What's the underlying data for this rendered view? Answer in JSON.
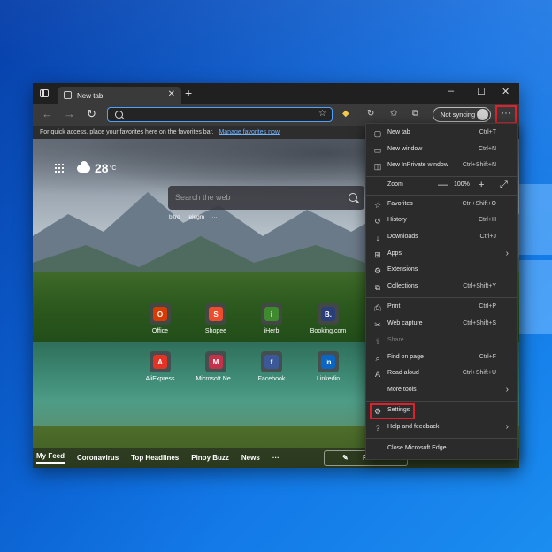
{
  "browser": {
    "tab_title": "New tab",
    "new_tab_symbol": "+",
    "window_controls": [
      "–",
      "☐",
      "✕"
    ],
    "address_placeholder": "",
    "sync_label": "Not syncing",
    "more_symbol": "···",
    "favorites_bar_text": "For quick access, place your favorites here on the favorites bar.",
    "favorites_bar_link": "Manage favorites now"
  },
  "newtab": {
    "temperature": "28",
    "temperature_unit": "°C",
    "search_placeholder": "Search the web",
    "quick_links": [
      "bitro",
      "telegm",
      "···"
    ],
    "tiles": [
      {
        "label": "Office",
        "color": "#d83b01",
        "glyph": "O"
      },
      {
        "label": "Shopee",
        "color": "#ee4d2d",
        "glyph": "S"
      },
      {
        "label": "iHerb",
        "color": "#3f8a2f",
        "glyph": "i"
      },
      {
        "label": "Booking.com",
        "color": "#2a3f7a",
        "glyph": "B."
      },
      {
        "label": "AliExpress",
        "color": "#e43225",
        "glyph": "A"
      },
      {
        "label": "Microsoft Ne...",
        "color": "#c4314b",
        "glyph": "M"
      },
      {
        "label": "Facebook",
        "color": "#3b5998",
        "glyph": "f"
      },
      {
        "label": "Linkedin",
        "color": "#0a66c2",
        "glyph": "in"
      }
    ],
    "feed_tabs": [
      "My Feed",
      "Coronavirus",
      "Top Headlines",
      "Pinoy Buzz",
      "News",
      "···"
    ],
    "personalize_label": "Personalize"
  },
  "menu": {
    "items": [
      {
        "label": "New tab",
        "shortcut": "Ctrl+T",
        "icon": "new-tab-icon",
        "glyph": "▢"
      },
      {
        "label": "New window",
        "shortcut": "Ctrl+N",
        "icon": "window-icon",
        "glyph": "▭"
      },
      {
        "label": "New InPrivate window",
        "shortcut": "Ctrl+Shift+N",
        "icon": "inprivate-icon",
        "glyph": "◫"
      },
      {
        "label": "Zoom",
        "shortcut": "",
        "icon": "",
        "glyph": ""
      },
      {
        "label": "Favorites",
        "shortcut": "Ctrl+Shift+O",
        "icon": "favorites-icon",
        "glyph": "☆"
      },
      {
        "label": "History",
        "shortcut": "Ctrl+H",
        "icon": "history-icon",
        "glyph": "↺"
      },
      {
        "label": "Downloads",
        "shortcut": "Ctrl+J",
        "icon": "download-icon",
        "glyph": "↓"
      },
      {
        "label": "Apps",
        "shortcut": "",
        "icon": "apps-icon",
        "glyph": "⊞"
      },
      {
        "label": "Extensions",
        "shortcut": "",
        "icon": "extensions-icon",
        "glyph": "⚙"
      },
      {
        "label": "Collections",
        "shortcut": "Ctrl+Shift+Y",
        "icon": "collections-icon",
        "glyph": "⧉"
      },
      {
        "label": "Print",
        "shortcut": "Ctrl+P",
        "icon": "print-icon",
        "glyph": "⎙"
      },
      {
        "label": "Web capture",
        "shortcut": "Ctrl+Shift+S",
        "icon": "capture-icon",
        "glyph": "✂"
      },
      {
        "label": "Share",
        "shortcut": "",
        "icon": "share-icon",
        "glyph": "⇪"
      },
      {
        "label": "Find on page",
        "shortcut": "Ctrl+F",
        "icon": "find-icon",
        "glyph": "⌕"
      },
      {
        "label": "Read aloud",
        "shortcut": "Ctrl+Shift+U",
        "icon": "read-aloud-icon",
        "glyph": "A"
      },
      {
        "label": "More tools",
        "shortcut": "",
        "icon": "",
        "glyph": ""
      },
      {
        "label": "Settings",
        "shortcut": "",
        "icon": "settings-icon",
        "glyph": "⚙"
      },
      {
        "label": "Help and feedback",
        "shortcut": "",
        "icon": "help-icon",
        "glyph": "?"
      },
      {
        "label": "Close Microsoft Edge",
        "shortcut": "",
        "icon": "",
        "glyph": ""
      }
    ],
    "zoom_minus": "—",
    "zoom_value": "100%",
    "zoom_plus": "+",
    "zoom_fullscreen": "⤢",
    "arrow": "›"
  },
  "colors": {
    "accent": "#4da3ff",
    "highlight": "#e0202a",
    "menu_bg": "#2b2b2b"
  }
}
